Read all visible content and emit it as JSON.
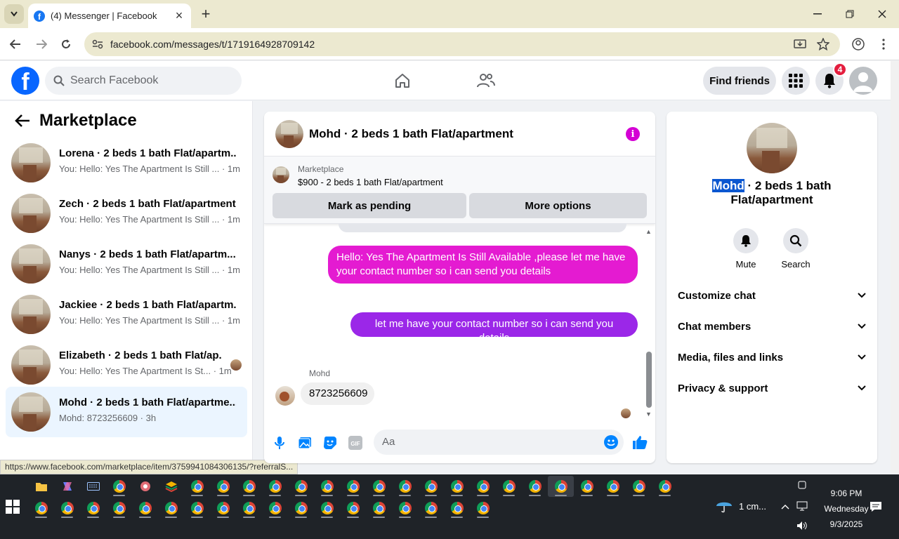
{
  "browser": {
    "tab_title": "(4) Messenger | Facebook",
    "url": "facebook.com/messages/t/1719164928709142",
    "status_url": "https://www.facebook.com/marketplace/item/3759941084306135/?referralS..."
  },
  "fb_header": {
    "search_placeholder": "Search Facebook",
    "find_friends": "Find friends",
    "notification_count": "4"
  },
  "left_panel": {
    "title": "Marketplace",
    "conversations": [
      {
        "name": "Lorena · 2 beds 1 bath Flat/apartm...",
        "preview": "You: Hello: Yes The Apartment Is Still ... · 1m"
      },
      {
        "name": "Zech · 2 beds 1 bath Flat/apartment",
        "preview": "You: Hello: Yes The Apartment Is Still ... · 1m"
      },
      {
        "name": "Nanys · 2 beds 1 bath Flat/apartm...",
        "preview": "You: Hello: Yes The Apartment Is Still ... · 1m"
      },
      {
        "name": "Jackiee · 2 beds 1 bath Flat/apartm...",
        "preview": "You: Hello: Yes The Apartment Is Still ... · 1m"
      },
      {
        "name": "Elizabeth · 2 beds 1 bath Flat/ap...",
        "preview": "You: Hello: Yes The Apartment Is St... · 1m"
      },
      {
        "name": "Mohd · 2 beds 1 bath Flat/apartme...",
        "preview": "Mohd: 8723256609 · 3h"
      }
    ]
  },
  "chat": {
    "title": "Mohd · 2 beds 1 bath Flat/apartment",
    "marketplace_label": "Marketplace",
    "listing": "$900 - 2 beds 1 bath Flat/apartment",
    "mark_pending": "Mark as pending",
    "more_options": "More options",
    "messages": [
      {
        "from": "me",
        "text": "Hello: Yes The Apartment Is Still Available ,please let me have your contact number so i can send you details"
      },
      {
        "from": "me",
        "text": "let me have your contact number so i can send you details"
      },
      {
        "from": "Mohd",
        "sender_label": "Mohd",
        "text": "8723256609"
      }
    ],
    "composer_placeholder": "Aa"
  },
  "right_panel": {
    "name_highlight": "Mohd",
    "name_rest": " · 2 beds 1 bath Flat/apartment",
    "mute": "Mute",
    "search": "Search",
    "sections": [
      "Customize chat",
      "Chat members",
      "Media, files and links",
      "Privacy & support"
    ]
  },
  "taskbar": {
    "time": "9:06 PM",
    "day": "Wednesday",
    "date": "9/3/2025",
    "weather": "1 cm..."
  },
  "colors": {
    "fb_blue": "#0866ff",
    "bubble_pink": "#e41bd1",
    "bubble_purple": "#9b27e8",
    "active_conv": "#ebf5ff"
  }
}
